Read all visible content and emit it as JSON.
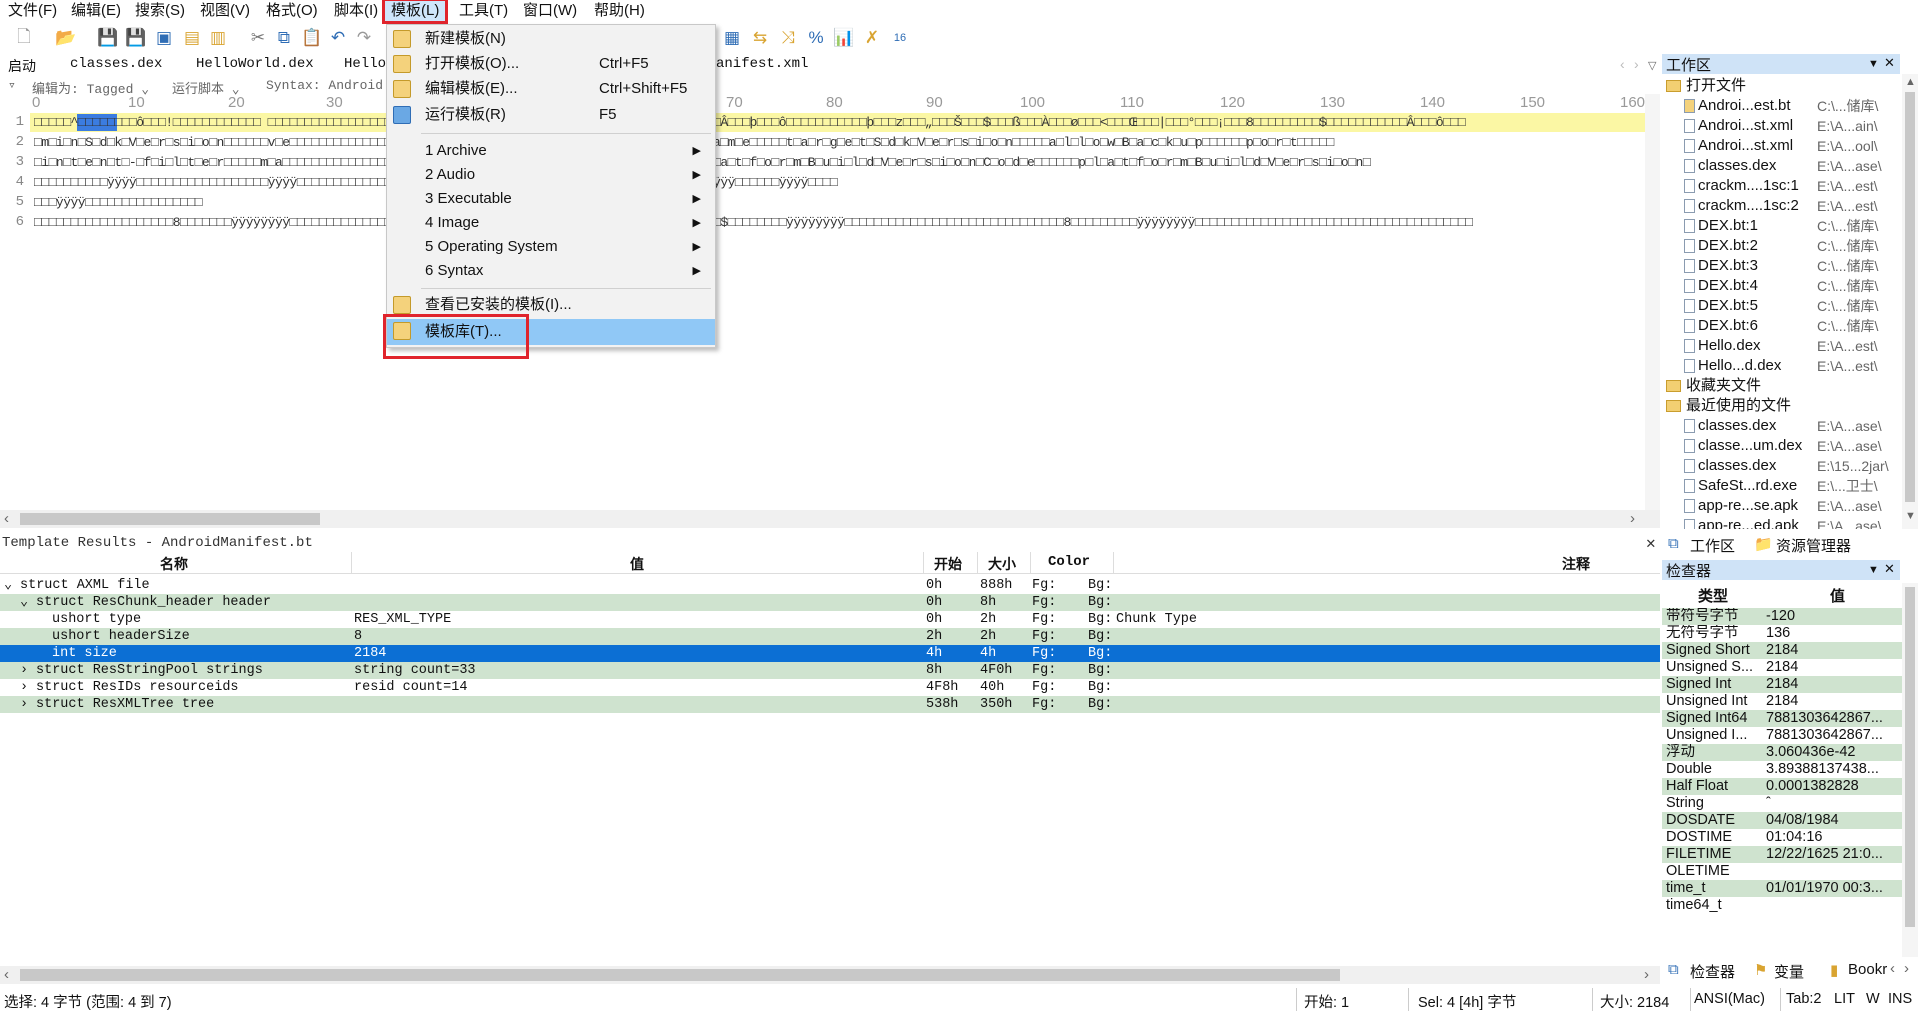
{
  "menubar": [
    "文件(F)",
    "编辑(E)",
    "搜索(S)",
    "视图(V)",
    "格式(O)",
    "脚本(I)",
    "模板(L)",
    "工具(T)",
    "窗口(W)",
    "帮助(H)"
  ],
  "tabs": [
    "启动",
    "classes.dex",
    "HelloWorld.dex",
    "Hello",
    "anifest.xml"
  ],
  "editor_bar": {
    "edit_as": "编辑为: Tagged ⌄",
    "run_script": "运行脚本 ⌄",
    "syntax": "Syntax: Android"
  },
  "ruler": [
    "0",
    "10",
    "20",
    "30",
    "70",
    "80",
    "90",
    "100",
    "110",
    "120",
    "130",
    "140",
    "150",
    "160"
  ],
  "editor_lines": [
    "□□□□□^□□□□□□□□ô□□□!□□□□□□□□□□□□ □□□□□□□□□□□□□□□□□□□□□□□□□□□□□□□□□□□□□□□□□□□□□□□□□□□□□□□□□□°□□□Â□□□þ□□□ô□□□□□□□□□□□þ□□□z□□□„□□□Š□□□$□□□ß□□□À□□□ø□□□<□□□Œ□□□|□□□°□□□¡□□□8□□□□□□□□□$□□□□□□□□□□□Â□□□ô□□□",
    "□m□i□n□S□d□k□V□e□r□s□i□o□n□□□□□□v□e□□□□□□□□□□□□□□□□□□□□□□□□□□□□□□□□□□□□□□□□□□□□□□□□□□□□□□□□N□a□m□e□□□□□t□a□r□g□e□t□S□d□k□V□e□r□s□i□o□n□□□□□a□l□l□o□w□B□a□c□k□u□p□□□□□□p□o□r□t□□□□□",
    "□i□n□t□e□n□t□-□f□i□l□t□e□r□□□□□m□a□□□□□□□□□□□□□□□□□□□□□□□□□□□□□□□□□□□□□□□□□□□□□□□□□□□□□□□□p□l□a□t□f□o□r□m□B□u□i□l□d□V□e□r□s□i□o□n□C□o□d□e□□□□□□p□l□a□t□f□o□r□m□B□u□i□l□d□V□e□r□s□i□o□n□",
    "□□□□□□□□□□ÿÿÿÿ□□□□□□□□□□□□□□□□□□ÿÿÿÿ□□□□□□□□□□□□□□□□□□□□□□□□□□□□□□□□□□□□□□□□□□□□□□□□□□□□□□□□ÿÿÿÿ□□□□□□ÿÿÿÿ□□□□",
    "□□□ÿÿÿÿ□□□□□□□□□□□□□□□□",
    "□□□□□□□□□□□□□□□□□□□8□□□□□□□ÿÿÿÿÿÿÿÿ□□□□□□□□□□□□□□□□□□□□□□□□□□□□□□□□□□□□□□□□□□□□□□□□□□□□□□□□□□□$□□□□□□□□ÿÿÿÿÿÿÿÿ□□□□□□□□□□□□□□□□□□□□□□□□□□□□□□8□□□□□□□□□ÿÿÿÿÿÿÿÿ□□□□□□□□□□□□□□□□□□□□□□□□□□□□□□□□□□□□□□"
  ],
  "dropdown": {
    "items": [
      {
        "label": "新建模板(N)",
        "shortcut": ""
      },
      {
        "label": "打开模板(O)...",
        "shortcut": "Ctrl+F5"
      },
      {
        "label": "编辑模板(E)...",
        "shortcut": "Ctrl+Shift+F5"
      },
      {
        "label": "运行模板(R)",
        "shortcut": "F5"
      }
    ],
    "submenus": [
      "1 Archive",
      "2 Audio",
      "3 Executable",
      "4 Image",
      "5 Operating System",
      "6 Syntax"
    ],
    "installed": "查看已安装的模板(I)...",
    "library": "模板库(T)..."
  },
  "template_results": {
    "title": "Template Results - AndroidManifest.bt",
    "headers": [
      "名称",
      "值",
      "开始",
      "大小",
      "Color",
      "注释"
    ],
    "rows": [
      {
        "name": "struct AXML file",
        "value": "",
        "start": "0h",
        "size": "888h",
        "fg": "Fg:",
        "bg": "Bg:",
        "comment": ""
      },
      {
        "name": "struct ResChunk_header header",
        "value": "",
        "start": "0h",
        "size": "8h",
        "fg": "Fg:",
        "bg": "Bg:",
        "comment": ""
      },
      {
        "name": "ushort type",
        "value": "RES_XML_TYPE",
        "start": "0h",
        "size": "2h",
        "fg": "Fg:",
        "bg": "Bg:",
        "comment": "Chunk Type"
      },
      {
        "name": "ushort headerSize",
        "value": "8",
        "start": "2h",
        "size": "2h",
        "fg": "Fg:",
        "bg": "Bg:",
        "comment": ""
      },
      {
        "name": "int size",
        "value": "2184",
        "start": "4h",
        "size": "4h",
        "fg": "Fg:",
        "bg": "Bg:",
        "comment": ""
      },
      {
        "name": "struct ResStringPool strings",
        "value": "string count=33",
        "start": "8h",
        "size": "4F0h",
        "fg": "Fg:",
        "bg": "Bg:",
        "comment": ""
      },
      {
        "name": "struct ResIDs resourceids",
        "value": "resid count=14",
        "start": "4F8h",
        "size": "40h",
        "fg": "Fg:",
        "bg": "Bg:",
        "comment": ""
      },
      {
        "name": "struct ResXMLTree tree",
        "value": "",
        "start": "538h",
        "size": "350h",
        "fg": "Fg:",
        "bg": "Bg:",
        "comment": ""
      }
    ]
  },
  "workspace": {
    "title": "工作区",
    "open_files_header": "打开文件",
    "open_files": [
      {
        "name": "Androi...est.bt",
        "path": "C:\\...储库\\"
      },
      {
        "name": "Androi...st.xml",
        "path": "E:\\A...ain\\"
      },
      {
        "name": "Androi...st.xml",
        "path": "E:\\A...ool\\"
      },
      {
        "name": "classes.dex",
        "path": "E:\\A...ase\\"
      },
      {
        "name": "crackm....1sc:1",
        "path": "E:\\A...est\\"
      },
      {
        "name": "crackm....1sc:2",
        "path": "E:\\A...est\\"
      },
      {
        "name": "DEX.bt:1",
        "path": "C:\\...储库\\"
      },
      {
        "name": "DEX.bt:2",
        "path": "C:\\...储库\\"
      },
      {
        "name": "DEX.bt:3",
        "path": "C:\\...储库\\"
      },
      {
        "name": "DEX.bt:4",
        "path": "C:\\...储库\\"
      },
      {
        "name": "DEX.bt:5",
        "path": "C:\\...储库\\"
      },
      {
        "name": "DEX.bt:6",
        "path": "C:\\...储库\\"
      },
      {
        "name": "Hello.dex",
        "path": "E:\\A...est\\"
      },
      {
        "name": "Hello...d.dex",
        "path": "E:\\A...est\\"
      }
    ],
    "favorites_header": "收藏夹文件",
    "recent_header": "最近使用的文件",
    "recent_files": [
      {
        "name": "classes.dex",
        "path": "E:\\A...ase\\"
      },
      {
        "name": "classe...um.dex",
        "path": "E:\\A...ase\\"
      },
      {
        "name": "classes.dex",
        "path": "E:\\15...2jar\\"
      },
      {
        "name": "SafeSt...rd.exe",
        "path": "E:\\...卫士\\"
      },
      {
        "name": "app-re...se.apk",
        "path": "E:\\A...ase\\"
      },
      {
        "name": "app-re...ed.apk",
        "path": "E:\\A...ase\\"
      }
    ],
    "bottom_tabs": [
      "工作区",
      "资源管理器"
    ]
  },
  "inspector": {
    "title": "检查器",
    "headers": [
      "类型",
      "值"
    ],
    "rows": [
      {
        "type": "带符号字节",
        "value": "-120"
      },
      {
        "type": "无符号字节",
        "value": "136"
      },
      {
        "type": "Signed Short",
        "value": "2184"
      },
      {
        "type": "Unsigned S...",
        "value": "2184"
      },
      {
        "type": "Signed Int",
        "value": "2184"
      },
      {
        "type": "Unsigned Int",
        "value": "2184"
      },
      {
        "type": "Signed Int64",
        "value": "7881303642867..."
      },
      {
        "type": "Unsigned I...",
        "value": "7881303642867..."
      },
      {
        "type": "浮动",
        "value": "3.060436e-42"
      },
      {
        "type": "Double",
        "value": "3.89388137438..."
      },
      {
        "type": "Half Float",
        "value": "0.0001382828"
      },
      {
        "type": "String",
        "value": "ˆ"
      },
      {
        "type": "DOSDATE",
        "value": "04/08/1984"
      },
      {
        "type": "DOSTIME",
        "value": "01:04:16"
      },
      {
        "type": "FILETIME",
        "value": "12/22/1625 21:0..."
      },
      {
        "type": "OLETIME",
        "value": ""
      },
      {
        "type": "time_t",
        "value": "01/01/1970 00:3..."
      },
      {
        "type": "time64_t",
        "value": ""
      }
    ],
    "bottom_tabs": [
      "检查器",
      "变量",
      "Bookr"
    ]
  },
  "status": {
    "selection": "选择: 4 字节 (范围: 4 到 7)",
    "start": "开始: 1",
    "sel": "Sel: 4 [4h] 字节",
    "size": "大小: 2184",
    "encoding": "ANSI(Mac)",
    "tab": "Tab:2",
    "lit": "LIT",
    "w": "W",
    "ins": "INS"
  }
}
